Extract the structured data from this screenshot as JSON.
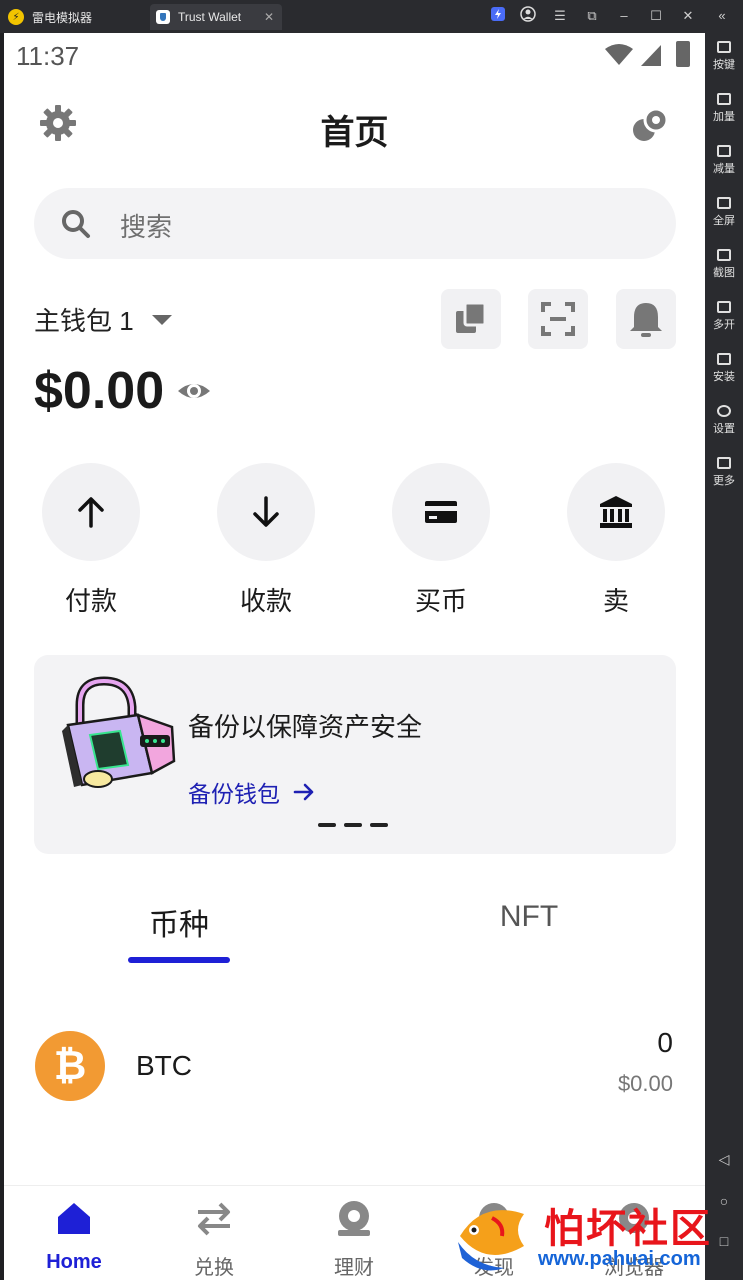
{
  "emulator": {
    "tabs": [
      {
        "label": "雷电模拟器"
      },
      {
        "label": "Trust Wallet"
      }
    ],
    "side_items": [
      {
        "label": "按键"
      },
      {
        "label": "加量"
      },
      {
        "label": "减量"
      },
      {
        "label": "全屏"
      },
      {
        "label": "截图"
      },
      {
        "label": "多开"
      },
      {
        "label": "安装"
      },
      {
        "label": "设置"
      },
      {
        "label": "更多"
      }
    ]
  },
  "status": {
    "time": "11:37"
  },
  "header": {
    "title": "首页"
  },
  "search": {
    "placeholder": "搜索"
  },
  "wallet": {
    "name": "主钱包 1",
    "balance": "$0.00"
  },
  "actions": [
    {
      "label": "付款",
      "icon": "arrow-up-icon"
    },
    {
      "label": "收款",
      "icon": "arrow-down-icon"
    },
    {
      "label": "买币",
      "icon": "card-icon"
    },
    {
      "label": "卖",
      "icon": "bank-icon"
    }
  ],
  "banner": {
    "title": "备份以保障资产安全",
    "link": "备份钱包"
  },
  "tabs": [
    {
      "label": "币种"
    },
    {
      "label": "NFT"
    }
  ],
  "assets": [
    {
      "symbol": "BTC",
      "amount": "0",
      "value": "$0.00"
    }
  ],
  "bottom_nav": [
    {
      "label": "Home"
    },
    {
      "label": "兑换"
    },
    {
      "label": "理财"
    },
    {
      "label": "发现"
    },
    {
      "label": "浏览器"
    }
  ],
  "watermark": {
    "text": "怕坏社区",
    "url": "www.pahuai.com"
  },
  "colors": {
    "accent": "#1e20d6",
    "btc": "#f29a33",
    "link": "#1e20b3"
  }
}
